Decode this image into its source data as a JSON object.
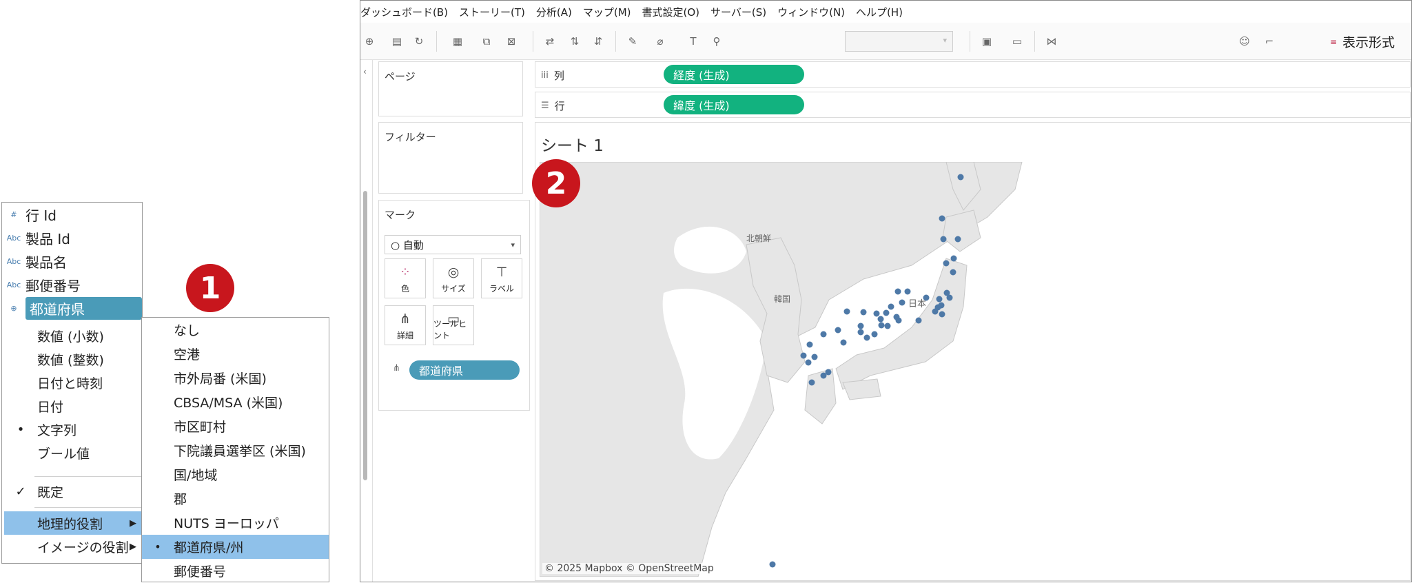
{
  "field_list": {
    "items": [
      {
        "type_icon": "#",
        "label": "行 Id"
      },
      {
        "type_icon": "Abc",
        "label": "製品 Id"
      },
      {
        "type_icon": "Abc",
        "label": "製品名"
      },
      {
        "type_icon": "Abc",
        "label": "郵便番号"
      },
      {
        "type_icon": "⊕",
        "label": "都道府県"
      }
    ]
  },
  "context_menu": {
    "items": [
      {
        "label": "数値 (小数)",
        "mark": ""
      },
      {
        "label": "数値 (整数)",
        "mark": ""
      },
      {
        "label": "日付と時刻",
        "mark": ""
      },
      {
        "label": "日付",
        "mark": ""
      },
      {
        "label": "文字列",
        "mark": "•"
      },
      {
        "label": "ブール値",
        "mark": ""
      },
      {
        "label": "既定",
        "mark": "✓"
      },
      {
        "label": "地理的役割",
        "mark": "",
        "arrow": "▶"
      },
      {
        "label": "イメージの役割",
        "mark": "",
        "arrow": "▶"
      }
    ]
  },
  "geo_submenu": {
    "items": [
      {
        "label": "なし",
        "mark": ""
      },
      {
        "label": "空港",
        "mark": ""
      },
      {
        "label": "市外局番 (米国)",
        "mark": ""
      },
      {
        "label": "CBSA/MSA (米国)",
        "mark": ""
      },
      {
        "label": "市区町村",
        "mark": ""
      },
      {
        "label": "下院議員選挙区 (米国)",
        "mark": ""
      },
      {
        "label": "国/地域",
        "mark": ""
      },
      {
        "label": "郡",
        "mark": ""
      },
      {
        "label": "NUTS ヨーロッパ",
        "mark": ""
      },
      {
        "label": "都道府県/州",
        "mark": "•"
      },
      {
        "label": "郵便番号",
        "mark": ""
      }
    ]
  },
  "badges": {
    "one": "1",
    "two": "2"
  },
  "colors": {
    "accent_red": "#c8161d",
    "pill_green": "#12b27f",
    "pill_blue": "#4a9bb8",
    "highlight": "#8fc1ea",
    "map_dot": "#4e79a7"
  },
  "menubar": [
    "ダッシュボード(B)",
    "ストーリー(T)",
    "分析(A)",
    "マップ(M)",
    "書式設定(O)",
    "サーバー(S)",
    "ウィンドウ(N)",
    "ヘルプ(H)"
  ],
  "toolbar": {
    "show_me": "表示形式"
  },
  "cards": {
    "pages": "ページ",
    "filters": "フィルター",
    "marks": "マーク",
    "mark_type": "○ 自動",
    "mark_buttons": [
      "色",
      "サイズ",
      "ラベル",
      "詳細",
      "ツールヒント"
    ],
    "mark_pill": "都道府県"
  },
  "shelves": {
    "columns_label": "列",
    "columns_pill": "経度 (生成)",
    "rows_label": "行",
    "rows_pill": "緯度 (生成)"
  },
  "sheet": {
    "title": "シート 1",
    "map_labels": [
      "北朝鮮",
      "韓国",
      "日本"
    ],
    "attribution": "© 2025 Mapbox © OpenStreetMap"
  }
}
